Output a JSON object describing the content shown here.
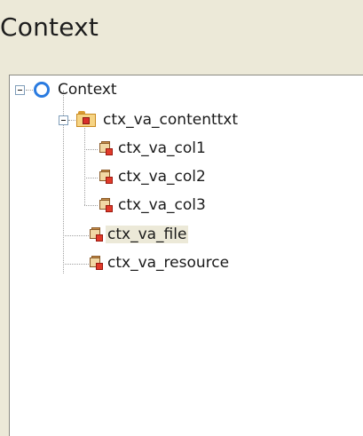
{
  "panel": {
    "title": "Context"
  },
  "tree": {
    "root": {
      "label": "Context",
      "icon": "context-circle-icon"
    },
    "group": {
      "label": "ctx_va_contenttxt",
      "icon": "folder-icon"
    },
    "group_children": [
      {
        "label": "ctx_va_col1",
        "icon": "attribute-icon"
      },
      {
        "label": "ctx_va_col2",
        "icon": "attribute-icon"
      },
      {
        "label": "ctx_va_col3",
        "icon": "attribute-icon"
      }
    ],
    "root_children": [
      {
        "label": "ctx_va_file",
        "icon": "attribute-icon",
        "selected": true
      },
      {
        "label": "ctx_va_resource",
        "icon": "attribute-icon"
      }
    ]
  },
  "colors": {
    "background": "#ece9d8",
    "tree_background": "#ffffff",
    "selection": "#ece9d8",
    "root_ring": "#2a7be0"
  }
}
